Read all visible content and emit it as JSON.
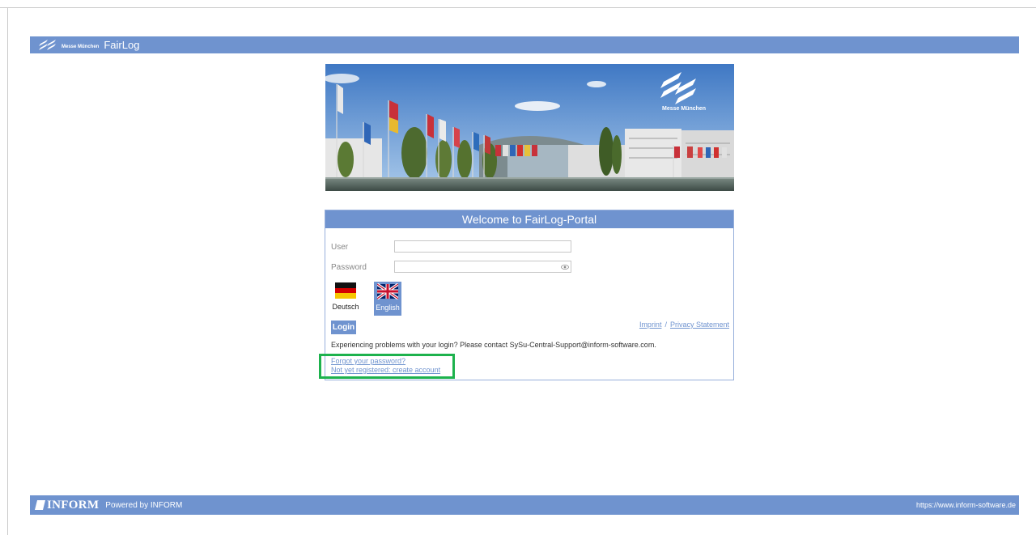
{
  "header": {
    "logo_text": "Messe München",
    "app_title": "FairLog"
  },
  "hero": {
    "logo_text": "Messe München"
  },
  "login_panel": {
    "title": "Welcome to FairLog-Portal",
    "user_label": "User",
    "user_value": "",
    "password_label": "Password",
    "password_value": "",
    "languages": [
      {
        "label": "Deutsch",
        "selected": false,
        "icon": "german-flag-icon"
      },
      {
        "label": "English",
        "selected": true,
        "icon": "uk-flag-icon"
      }
    ],
    "login_label": "Login",
    "imprint_label": "Imprint",
    "separator": "/",
    "privacy_label": "Privacy Statement",
    "help_text": "Experiencing problems with your login? Please contact SySu-Central-Support@inform-software.com.",
    "forgot_password_label": "Forgot your password?",
    "register_label": "Not yet registered: create account"
  },
  "footer": {
    "brand": "INFORM",
    "powered_by": "Powered by INFORM",
    "url": "https://www.inform-software.de"
  },
  "colors": {
    "accent": "#6f93cf",
    "highlight": "#1db24d"
  }
}
